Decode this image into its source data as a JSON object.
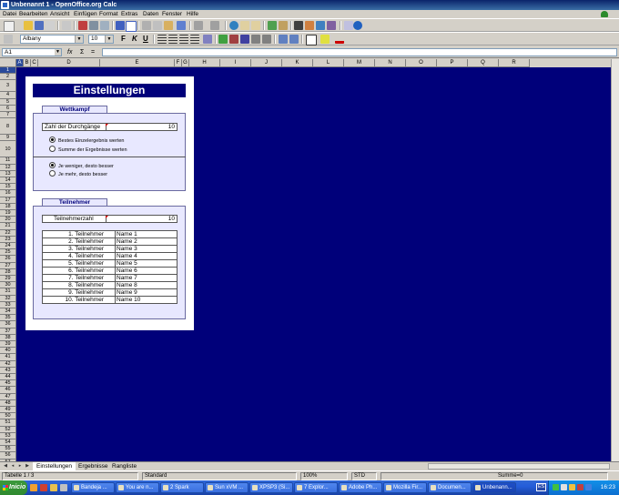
{
  "window": {
    "title": "Unbenannt 1 - OpenOffice.org Calc"
  },
  "menu": [
    "Datei",
    "Bearbeiten",
    "Ansicht",
    "Einfügen",
    "Format",
    "Extras",
    "Daten",
    "Fenster",
    "Hilfe"
  ],
  "format_toolbar": {
    "font_name": "Albany",
    "font_size": "10",
    "bold": "F",
    "italic": "K",
    "underline": "U"
  },
  "formula_bar": {
    "cell_ref": "A1",
    "fx": "fx",
    "sum": "Σ",
    "equals": "="
  },
  "columns": [
    "A",
    "B",
    "C",
    "D",
    "E",
    "F",
    "G",
    "H",
    "I",
    "J",
    "K",
    "L",
    "M",
    "N",
    "O",
    "P",
    "Q",
    "R"
  ],
  "rows": [
    "1",
    "2",
    "3",
    "4",
    "5",
    "6",
    "7",
    "8",
    "9",
    "10",
    "11",
    "12",
    "13",
    "14",
    "15",
    "16",
    "17",
    "18",
    "19",
    "20",
    "21",
    "22",
    "23",
    "24",
    "25",
    "26",
    "27",
    "28",
    "29",
    "30",
    "31",
    "32",
    "33",
    "34",
    "35",
    "36",
    "37",
    "38",
    "39",
    "40",
    "41",
    "42",
    "43",
    "44",
    "45",
    "46",
    "47",
    "48",
    "49",
    "50",
    "51",
    "52",
    "53",
    "54",
    "55",
    "56",
    "57",
    "58",
    "59",
    "60",
    "61",
    "62",
    "63",
    "64",
    "65"
  ],
  "panel": {
    "title": "Einstellungen",
    "wettkampf": {
      "label": "Wettkampf",
      "field_label": "Zahl der Durchgänge",
      "field_value": "10",
      "radio_a1": "Bestes Einzelergebnis werten",
      "radio_a2": "Summe der Ergebnisse werten",
      "radio_b1": "Je weniger, desto besser",
      "radio_b2": "Je mehr, desto besser"
    },
    "teilnehmer": {
      "label": "Teilnehmer",
      "field_label": "Teilnehmerzahl",
      "field_value": "10",
      "list": [
        {
          "n": "1. Teilnehmer",
          "name": "Name 1"
        },
        {
          "n": "2. Teilnehmer",
          "name": "Name 2"
        },
        {
          "n": "3. Teilnehmer",
          "name": "Name 3"
        },
        {
          "n": "4. Teilnehmer",
          "name": "Name 4"
        },
        {
          "n": "5. Teilnehmer",
          "name": "Name 5"
        },
        {
          "n": "6. Teilnehmer",
          "name": "Name 6"
        },
        {
          "n": "7. Teilnehmer",
          "name": "Name 7"
        },
        {
          "n": "8. Teilnehmer",
          "name": "Name 8"
        },
        {
          "n": "9. Teilnehmer",
          "name": "Name 9"
        },
        {
          "n": "10. Teilnehmer",
          "name": "Name 10"
        }
      ]
    }
  },
  "sheet_tabs": [
    "Einstellungen",
    "Ergebnisse",
    "Rangliste"
  ],
  "status": {
    "sheet": "Tabelle 1 / 3",
    "style": "Standard",
    "zoom": "100%",
    "mode": "STD",
    "sum": "Summe=0"
  },
  "taskbar": {
    "start": "Inicio",
    "tasks": [
      "Bandeja ...",
      "You are n...",
      "2 Spark",
      "Sun xVM ...",
      "XPSP3 (Si...",
      "7 Explor...",
      "Adobe Ph...",
      "Mozilla Fir...",
      "Documen...",
      "Unbenann..."
    ],
    "lang": "ES",
    "clock": "16:23"
  },
  "colors": {
    "sheet_bg": "#00007a",
    "panel_fill": "#e8e8ff",
    "accent_red": "#cc0000"
  }
}
